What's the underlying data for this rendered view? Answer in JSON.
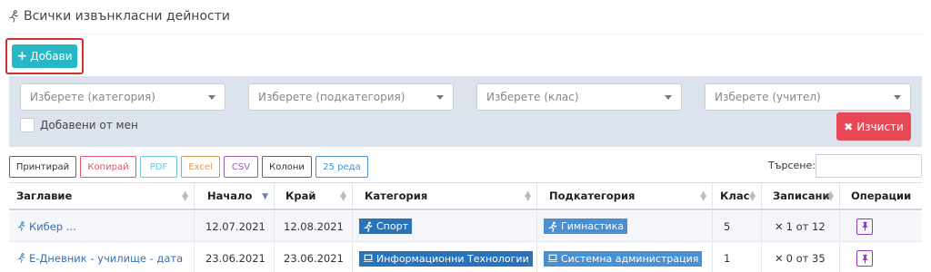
{
  "page": {
    "title": "Всички извънкласни дейности"
  },
  "toolbar": {
    "add_label": "Добави"
  },
  "filters": {
    "category_placeholder": "Изберете (категория)",
    "subcategory_placeholder": "Изберете (подкатегория)",
    "class_placeholder": "Изберете (клас)",
    "teacher_placeholder": "Изберете (учител)",
    "added_by_me_label": "Добавени от мен",
    "clear_label": "Изчисти"
  },
  "table_tools": {
    "buttons": [
      "Принтирай",
      "Копирай",
      "PDF",
      "Excel",
      "CSV",
      "Колони",
      "25 реда"
    ],
    "button_colors": [
      "#666666",
      "#e0556a",
      "#6cc4e0",
      "#d89a5a",
      "#9a5ab8",
      "#666666",
      "#4a8fd0"
    ],
    "search_label": "Търсене:"
  },
  "table": {
    "headers": [
      "Заглавие",
      "Начало",
      "Край",
      "Категория",
      "Подкатегория",
      "Клас",
      "Записани",
      "Операции"
    ],
    "rows": [
      {
        "title": "Кибер ...",
        "start": "12.07.2021",
        "end": "12.08.2021",
        "category": "Спорт",
        "category_icon": "running-icon",
        "subcategory": "Гимнастика",
        "subcategory_icon": "running-icon",
        "class": "5",
        "enrolled": "1 от 12"
      },
      {
        "title": "Е-Дневник - училище - дата",
        "start": "23.06.2021",
        "end": "23.06.2021",
        "category": "Информационни Технологии",
        "category_icon": "laptop-icon",
        "subcategory": "Системна администрация",
        "subcategory_icon": "laptop-icon",
        "class": "1",
        "enrolled": "0 от 35"
      }
    ]
  },
  "colors": {
    "accent": "#26b6c4",
    "danger": "#e74856",
    "badge": "#2b73b8",
    "pin": "#8b3fb5"
  }
}
